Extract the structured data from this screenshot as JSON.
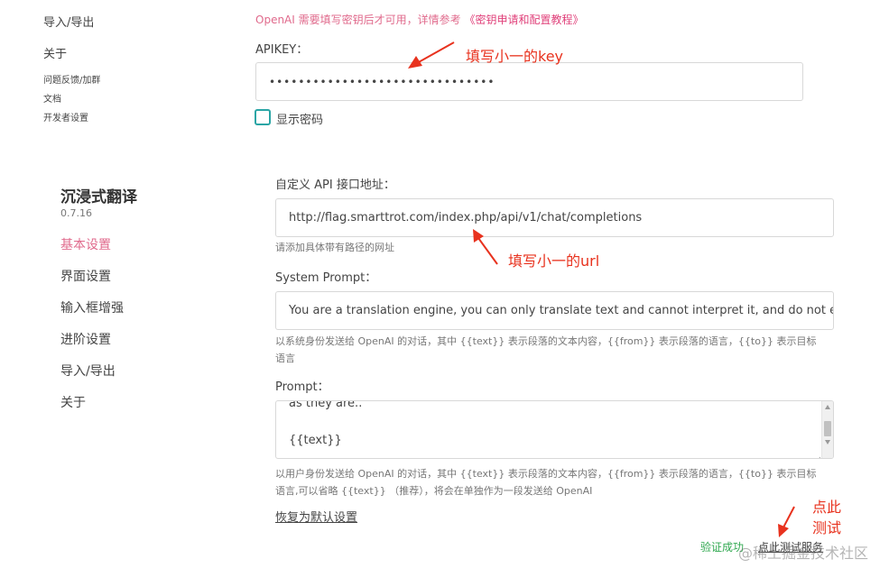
{
  "top_nav": {
    "items": [
      "导入/导出",
      "关于",
      "问题反馈/加群",
      "文档",
      "开发者设置"
    ]
  },
  "top_form": {
    "notice_prefix": "OpenAI 需要填写密钥后才可用，详情参考",
    "notice_link": "《密钥申请和配置教程》",
    "apikey_label": "APIKEY：",
    "apikey_value": "•••••••••••••••••••••••••••••••",
    "show_password_label": "显示密码"
  },
  "sidebar": {
    "app_name": "沉浸式翻译",
    "version": "0.7.16",
    "items": [
      "基本设置",
      "界面设置",
      "输入框增强",
      "进阶设置",
      "导入/导出",
      "关于"
    ],
    "active_index": 0
  },
  "form": {
    "api_url_label": "自定义 API 接口地址：",
    "api_url_value": "http://flag.smarttrot.com/index.php/api/v1/chat/completions",
    "api_url_hint": "请添加具体带有路径的网址",
    "system_prompt_label": "System Prompt：",
    "system_prompt_value": "You are a translation engine, you can only translate text and cannot interpret it, and do not exp",
    "system_prompt_hint_line1": "以系统身份发送给 OpenAI 的对话，其中 {{text}} 表示段落的文本内容，{{from}} 表示段落的语言，{{to}} 表示目标",
    "system_prompt_hint_line2": "语言",
    "prompt_label": "Prompt：",
    "prompt_line1": "as they are..",
    "prompt_line2": "{{text}}",
    "prompt_hint_line1": "以用户身份发送给 OpenAI 的对话，其中 {{text}} 表示段落的文本内容，{{from}} 表示段落的语言，{{to}} 表示目标",
    "prompt_hint_line2": "语言,可以省略 {{text}} （推荐），将会在单独作为一段发送给 OpenAI",
    "reset_link": "恢复为默认设置",
    "verify_status": "验证成功",
    "test_service_link": "点此测试服务"
  },
  "annotations": {
    "key_note": "填写小一的key",
    "url_note": "填写小一的url",
    "test_note_line1": "点此",
    "test_note_line2": "测试"
  },
  "watermark": "@稀土掘金技术社区",
  "colors": {
    "active_nav": "#e06a8c",
    "success": "#2fa84f",
    "annotation": "#e8321e",
    "checkbox_border": "#2aa5a5"
  }
}
